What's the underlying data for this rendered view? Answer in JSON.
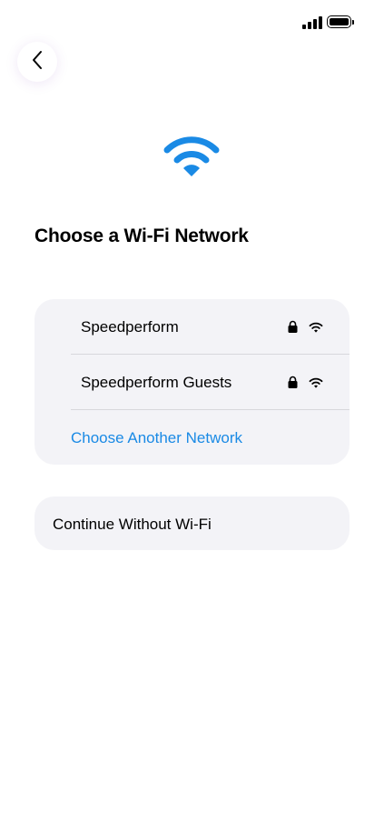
{
  "status_bar": {
    "signal_icon": "cellular-signal-icon",
    "battery_icon": "battery-icon",
    "battery_level": 1.0
  },
  "header": {
    "back_icon": "chevron-left-icon"
  },
  "hero": {
    "icon": "wifi-icon",
    "icon_color": "#1a8ae5"
  },
  "title": "Choose a Wi-Fi Network",
  "networks": [
    {
      "name": "Speedperform",
      "secured": true,
      "lock_icon": "lock-icon",
      "signal_icon": "wifi-icon"
    },
    {
      "name": "Speedperform Guests",
      "secured": true,
      "lock_icon": "lock-icon",
      "signal_icon": "wifi-icon"
    }
  ],
  "another_network_label": "Choose Another Network",
  "continue_label": "Continue Without Wi-Fi",
  "colors": {
    "accent": "#1a8ae5",
    "card_background": "#f3f3f7",
    "divider": "#d7d7dc"
  }
}
